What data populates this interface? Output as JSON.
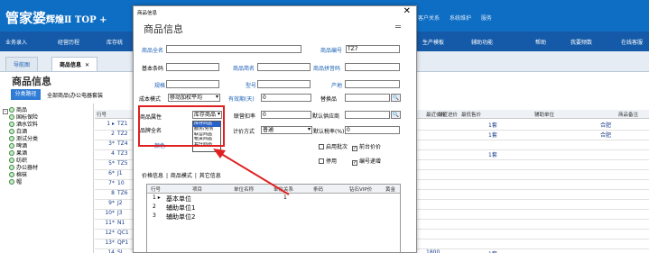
{
  "app": {
    "logo": "管家婆",
    "logo_sub": "辉煌Ⅱ TOP +",
    "top_links": [
      "客户关系",
      "系统维护",
      "服务"
    ]
  },
  "menu": {
    "left": [
      "业务录入",
      "经营历程",
      "库存统"
    ],
    "right": [
      "生产模板",
      "辅助功能",
      "帮助",
      "我要频数",
      "在线客服"
    ]
  },
  "tabs": {
    "nav": "导航图",
    "goods": "商品信息",
    "close": "✕"
  },
  "content": {
    "title": "商品信息",
    "path_button": "分类路径",
    "path_text": "全部商品\\办公电器套装"
  },
  "tree": {
    "root": "商品",
    "items": [
      "国标保险",
      "酒水饮料",
      "白酒",
      "测试分类",
      "啤酒",
      "果酒",
      "纺织",
      "办公器材",
      "棉袜",
      "帽"
    ]
  },
  "grid": {
    "headers": [
      "行号",
      "最近价格",
      "最近进价",
      "最低售价",
      "辅助单位",
      "商品备注"
    ],
    "rows": [
      {
        "n": "1 ▸",
        "code": "TZ1",
        "unit": "1套",
        "note": "合肥",
        "price": ""
      },
      {
        "n": "2",
        "code": "TZ2",
        "unit": "1套",
        "note": "合肥",
        "price": ""
      },
      {
        "n": "3*",
        "code": "TZ4",
        "unit": "",
        "note": "",
        "price": ""
      },
      {
        "n": "4",
        "code": "TZ3",
        "unit": "1套",
        "note": "",
        "price": ""
      },
      {
        "n": "5*",
        "code": "TZ5",
        "unit": "",
        "note": "",
        "price": ""
      },
      {
        "n": "6*",
        "code": "J1",
        "unit": "",
        "note": "",
        "price": ""
      },
      {
        "n": "7*",
        "code": "10",
        "unit": "",
        "note": "",
        "price": ""
      },
      {
        "n": "8",
        "code": "TZ6",
        "unit": "",
        "note": "",
        "price": ""
      },
      {
        "n": "9*",
        "code": "J2",
        "unit": "",
        "note": "",
        "price": ""
      },
      {
        "n": "10*",
        "code": "J3",
        "unit": "",
        "note": "",
        "price": ""
      },
      {
        "n": "11*",
        "code": "N1",
        "unit": "",
        "note": "",
        "price": ""
      },
      {
        "n": "12*",
        "code": "QC1",
        "unit": "",
        "note": "",
        "price": ""
      },
      {
        "n": "13*",
        "code": "QP1",
        "unit": "",
        "note": "",
        "price": ""
      },
      {
        "n": "14",
        "code": "SL",
        "unit": "1套",
        "note": "",
        "price": "1800"
      }
    ]
  },
  "modal": {
    "titlebar": "商品信息",
    "heading": "商品信息",
    "close": "✕",
    "collapse": "═",
    "labels": {
      "full_name": "商品全名",
      "code": "商品编号",
      "barcode": "基本条码",
      "short_name": "商品简名",
      "pinyin": "商品拼音码",
      "spec": "规格",
      "model": "型号",
      "origin": "产地",
      "cost_mode": "成本模式",
      "expiry": "有效期(天)",
      "substitute": "替换品",
      "attribute": "商品属性",
      "discount": "联营扣率",
      "default_supplier": "默认供应商",
      "brand": "品牌全名",
      "tax_mode": "计价方式",
      "tax_rate": "默认税率(%)",
      "color": "颜色",
      "batch": "启用批次",
      "front_price": "前台价价",
      "disabled": "停用",
      "auto_number": "编号递增"
    },
    "values": {
      "code": "TZ7",
      "cost_mode": "移动加权平均",
      "expiry": "0",
      "attribute": "库存商品",
      "discount": "0",
      "tax_mode": "普通",
      "tax_rate": "0"
    },
    "attribute_options": [
      "库存商品",
      "服务/劳务",
      "联营商品",
      "租赁商品",
      "套件商品"
    ],
    "checks": {
      "batch": false,
      "front_price": true,
      "disabled": false,
      "auto_number": true
    },
    "tabs2": [
      "价格信息",
      "|",
      "商品模式",
      "|",
      "其它信息"
    ],
    "unit_table": {
      "headers": [
        "行号",
        "项目",
        "单位名称",
        "单位关系",
        "条码",
        "钻石VIP价",
        "黄金"
      ],
      "rows": [
        {
          "n": "1 ▸",
          "name": "基本单位",
          "rel": "1"
        },
        {
          "n": "2",
          "name": "辅助单位1",
          "rel": ""
        },
        {
          "n": "3",
          "name": "辅助单位2",
          "rel": ""
        }
      ]
    }
  }
}
